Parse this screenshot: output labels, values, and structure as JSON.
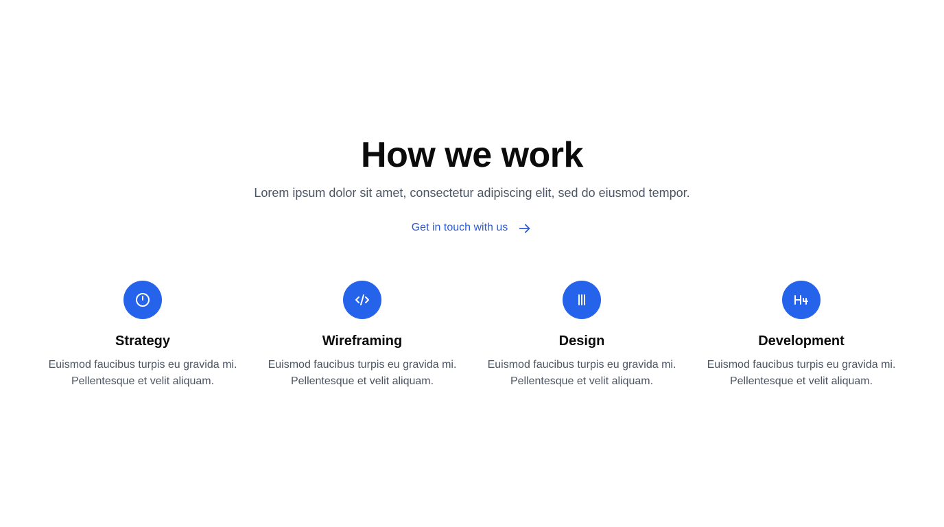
{
  "section": {
    "title": "How we work",
    "subtitle": "Lorem ipsum dolor sit amet, consectetur adipiscing elit, sed do eiusmod tempor.",
    "cta": {
      "label": "Get in touch with us",
      "icon": "arrow-right-icon"
    }
  },
  "colors": {
    "accent": "#2563eb",
    "link": "#2b5bd7",
    "heading": "#0b0b0b",
    "body_text": "#4b5563"
  },
  "features": [
    {
      "icon": "clock-icon",
      "title": "Strategy",
      "description": "Euismod faucibus turpis eu gravida mi. Pellentesque et velit aliquam."
    },
    {
      "icon": "code-icon",
      "title": "Wireframing",
      "description": "Euismod faucibus turpis eu gravida mi. Pellentesque et velit aliquam."
    },
    {
      "icon": "columns-icon",
      "title": "Design",
      "description": "Euismod faucibus turpis eu gravida mi. Pellentesque et velit aliquam."
    },
    {
      "icon": "heading-h4-icon",
      "title": "Development",
      "description": "Euismod faucibus turpis eu gravida mi. Pellentesque et velit aliquam."
    }
  ]
}
